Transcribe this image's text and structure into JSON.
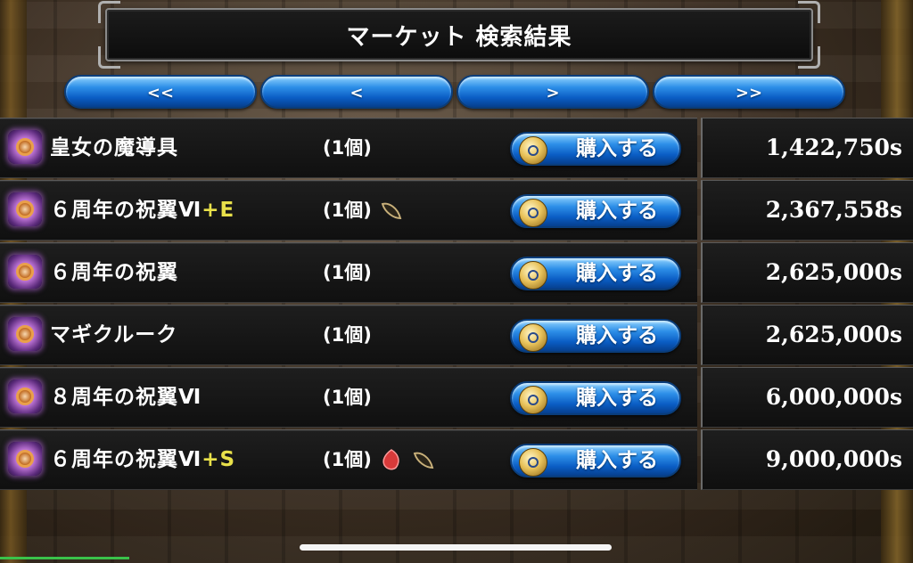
{
  "title": "マーケット 検索結果",
  "nav": {
    "first": "<<",
    "prev": "<",
    "next": ">",
    "last": ">>"
  },
  "buy_label": "購入する",
  "items": [
    {
      "name": "皇女の魔導具",
      "suffix": "",
      "qty": "(1個)",
      "gems": [],
      "price": "1,422,750s"
    },
    {
      "name": "６周年の祝翼Ⅵ",
      "suffix": "+E",
      "qty": "(1個)",
      "gems": [
        "seed-gem"
      ],
      "price": "2,367,558s"
    },
    {
      "name": "６周年の祝翼",
      "suffix": "",
      "qty": "(1個)",
      "gems": [],
      "price": "2,625,000s"
    },
    {
      "name": "マギクルーク",
      "suffix": "",
      "qty": "(1個)",
      "gems": [],
      "price": "2,625,000s"
    },
    {
      "name": "８周年の祝翼Ⅵ",
      "suffix": "",
      "qty": "(1個)",
      "gems": [],
      "price": "6,000,000s"
    },
    {
      "name": "６周年の祝翼Ⅵ",
      "suffix": "+S",
      "qty": "(1個)",
      "gems": [
        "red-gem",
        "seed-gem"
      ],
      "price": "9,000,000s"
    }
  ],
  "colors": {
    "button_blue": "#2d8fe8",
    "suffix_yellow": "#e8e04a",
    "text_white": "#ffffff"
  }
}
